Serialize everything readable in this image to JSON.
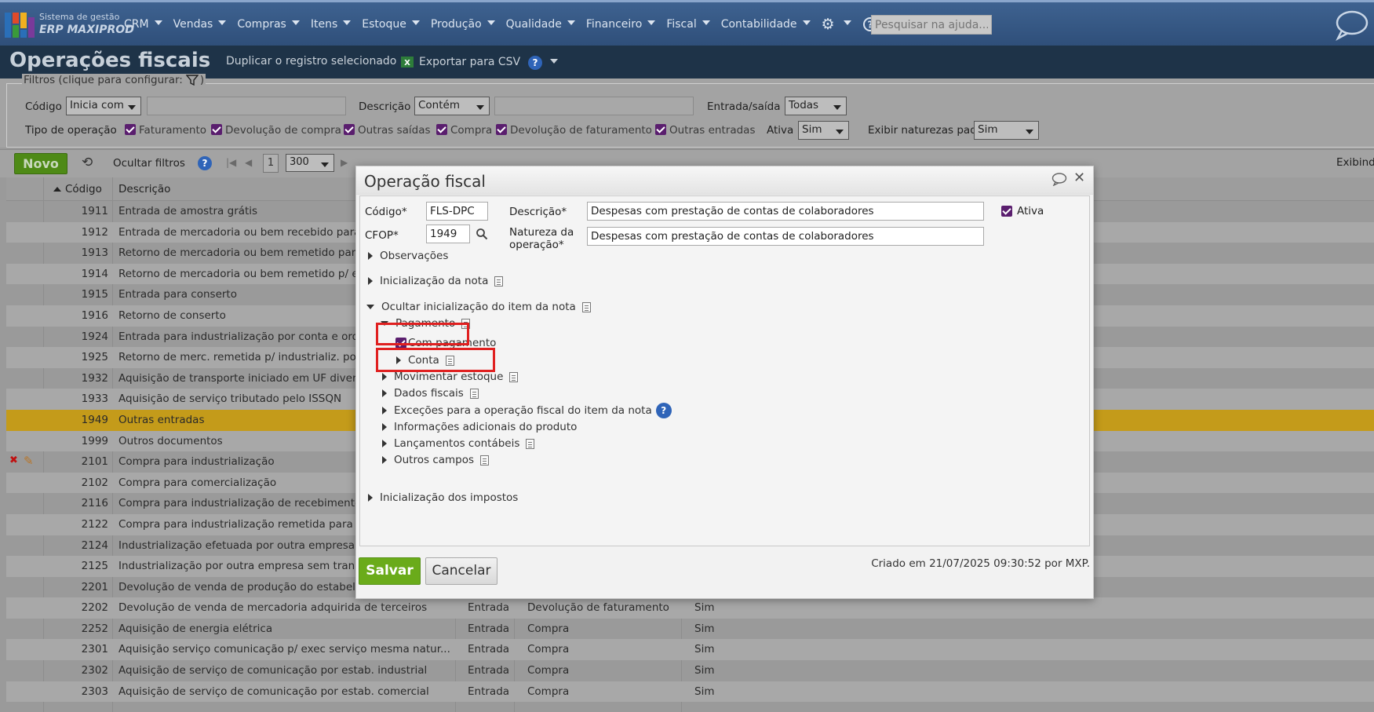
{
  "nav": {
    "logo_line1": "Sistema de gestão",
    "logo_line2": "ERP MAXIPROD",
    "menu": [
      "CRM",
      "Vendas",
      "Compras",
      "Itens",
      "Estoque",
      "Produção",
      "Qualidade",
      "Financeiro",
      "Fiscal",
      "Contabilidade"
    ],
    "search_placeholder": "Pesquisar na ajuda..."
  },
  "header": {
    "title": "Operações fiscais",
    "duplicate": "Duplicar o registro selecionado",
    "export": "Exportar para CSV"
  },
  "filters": {
    "legend": "Filtros (clique para configurar:",
    "legend_close": ")",
    "codigo_label": "Código",
    "codigo_mode": "Inicia com",
    "descricao_label": "Descrição",
    "descricao_mode": "Contém",
    "entrada_label": "Entrada/saída",
    "entrada_value": "Todas",
    "tipo_label": "Tipo de operação",
    "tipos": [
      "Faturamento",
      "Devolução de compra",
      "Outras saídas",
      "Compra",
      "Devolução de faturamento",
      "Outras entradas"
    ],
    "ativa_label": "Ativa",
    "ativa_value": "Sim",
    "naturezas_label": "Exibir naturezas padrão",
    "naturezas_value": "Sim"
  },
  "toolbar": {
    "novo": "Novo",
    "ocultar": "Ocultar filtros",
    "page": "1",
    "page_size": "300",
    "exibindo": "Exibind"
  },
  "grid": {
    "col_codigo": "Código",
    "col_descricao": "Descrição",
    "rows": [
      {
        "code": "1911",
        "desc": "Entrada de amostra grátis",
        "es": "",
        "tipo": "",
        "ativa": ""
      },
      {
        "code": "1912",
        "desc": "Entrada de mercadoria ou bem recebido para",
        "es": "",
        "tipo": "",
        "ativa": ""
      },
      {
        "code": "1913",
        "desc": "Retorno de mercadoria ou bem remetido para",
        "es": "",
        "tipo": "",
        "ativa": ""
      },
      {
        "code": "1914",
        "desc": "Retorno de mercadoria ou bem remetido p/ e",
        "es": "",
        "tipo": "",
        "ativa": ""
      },
      {
        "code": "1915",
        "desc": "Entrada para conserto",
        "es": "",
        "tipo": "",
        "ativa": ""
      },
      {
        "code": "1916",
        "desc": "Retorno de conserto",
        "es": "",
        "tipo": "",
        "ativa": ""
      },
      {
        "code": "1924",
        "desc": "Entrada para industrialização por conta e ord",
        "es": "",
        "tipo": "",
        "ativa": ""
      },
      {
        "code": "1925",
        "desc": "Retorno de merc. remetida p/ industrializ. po",
        "es": "",
        "tipo": "",
        "ativa": ""
      },
      {
        "code": "1932",
        "desc": "Aquisição de transporte iniciado em UF diver",
        "es": "",
        "tipo": "",
        "ativa": ""
      },
      {
        "code": "1933",
        "desc": "Aquisição de serviço tributado pelo ISSQN",
        "es": "",
        "tipo": "",
        "ativa": ""
      },
      {
        "code": "1949",
        "desc": "Outras entradas",
        "es": "",
        "tipo": "",
        "ativa": ""
      },
      {
        "code": "1999",
        "desc": "Outros documentos",
        "es": "",
        "tipo": "",
        "ativa": ""
      },
      {
        "code": "2101",
        "desc": "Compra para industrialização",
        "es": "",
        "tipo": "",
        "ativa": ""
      },
      {
        "code": "2102",
        "desc": "Compra para comercialização",
        "es": "",
        "tipo": "",
        "ativa": ""
      },
      {
        "code": "2116",
        "desc": "Compra para industrialização de recebimento",
        "es": "",
        "tipo": "",
        "ativa": ""
      },
      {
        "code": "2122",
        "desc": "Compra para industrialização remetida para i",
        "es": "",
        "tipo": "",
        "ativa": ""
      },
      {
        "code": "2124",
        "desc": "Industrialização efetuada por outra empresa",
        "es": "",
        "tipo": "",
        "ativa": ""
      },
      {
        "code": "2125",
        "desc": "Industrialização por outra empresa sem trans",
        "es": "",
        "tipo": "",
        "ativa": ""
      },
      {
        "code": "2201",
        "desc": "Devolução de venda de produção do estabele",
        "es": "",
        "tipo": "",
        "ativa": ""
      },
      {
        "code": "2202",
        "desc": "Devolução de venda de mercadoria adquirida de terceiros",
        "es": "Entrada",
        "tipo": "Devolução de faturamento",
        "ativa": "Sim"
      },
      {
        "code": "2252",
        "desc": "Aquisição de energia elétrica",
        "es": "Entrada",
        "tipo": "Compra",
        "ativa": "Sim"
      },
      {
        "code": "2301",
        "desc": "Aquisição serviço comunicação p/ exec serviço mesma natur...",
        "es": "Entrada",
        "tipo": "Compra",
        "ativa": "Sim"
      },
      {
        "code": "2302",
        "desc": "Aquisição de serviço de comunicação por estab. industrial",
        "es": "Entrada",
        "tipo": "Compra",
        "ativa": "Sim"
      },
      {
        "code": "2303",
        "desc": "Aquisição de serviço de comunicação por estab. comercial",
        "es": "Entrada",
        "tipo": "Compra",
        "ativa": "Sim"
      }
    ]
  },
  "modal": {
    "title": "Operação fiscal",
    "codigo_label": "Código*",
    "codigo_value": "FLS-DPC",
    "descricao_label": "Descrição*",
    "descricao_value": "Despesas com prestação de contas de colaboradores",
    "ativa_label": "Ativa",
    "cfop_label": "CFOP*",
    "cfop_value": "1949",
    "natureza_label_1": "Natureza da",
    "natureza_label_2": "operação*",
    "natureza_value": "Despesas com prestação de contas de colaboradores",
    "observacoes": "Observações",
    "inicializacao_nota": "Inicialização da nota",
    "ocultar_item": "Ocultar inicialização do item da nota",
    "pagamento": "Pagamento",
    "com_pagamento": "Com pagamento",
    "conta": "Conta",
    "movimentar_estoque": "Movimentar estoque",
    "dados_fiscais": "Dados fiscais",
    "excecoes": "Exceções para a operação fiscal do item da nota",
    "info_adicionais": "Informações adicionais do produto",
    "lancamentos": "Lançamentos contábeis",
    "outros_campos": "Outros campos",
    "inicializacao_impostos": "Inicialização dos impostos",
    "salvar": "Salvar",
    "cancelar": "Cancelar",
    "created": "Criado em 21/07/2025 09:30:52 por MXP."
  }
}
